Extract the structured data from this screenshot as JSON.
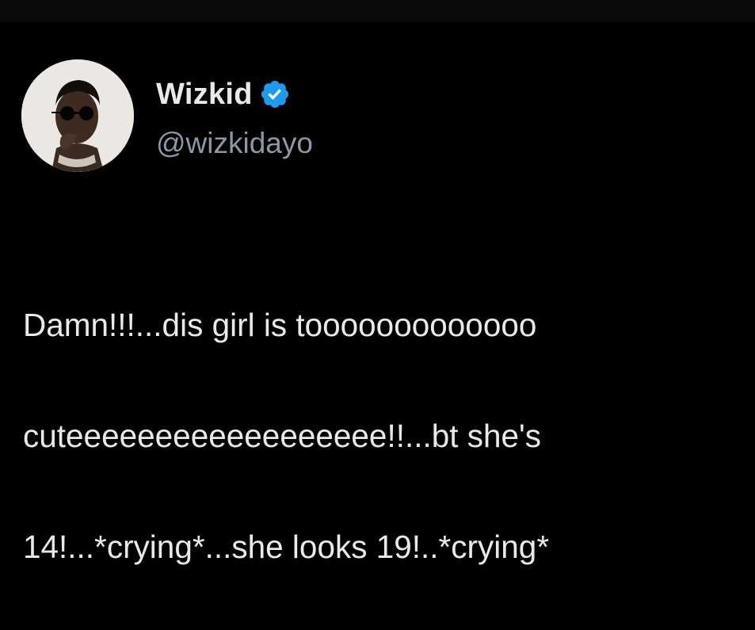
{
  "tweet": {
    "author": {
      "display_name": "Wizkid",
      "handle": "@wizkidayo",
      "verified": true,
      "verified_color": "#1d9bf0",
      "avatar_icon": "profile-photo"
    },
    "text_lines": [
      "Damn!!!...dis girl is tooooooooooooo",
      "cuteeeeeeeeeeeeeeeeee!!...bt she's",
      "14!...*crying*...she looks 19!..*crying*"
    ]
  },
  "colors": {
    "background": "#000000",
    "text_primary": "#e7e9ea",
    "text_secondary": "#8b98a5"
  }
}
